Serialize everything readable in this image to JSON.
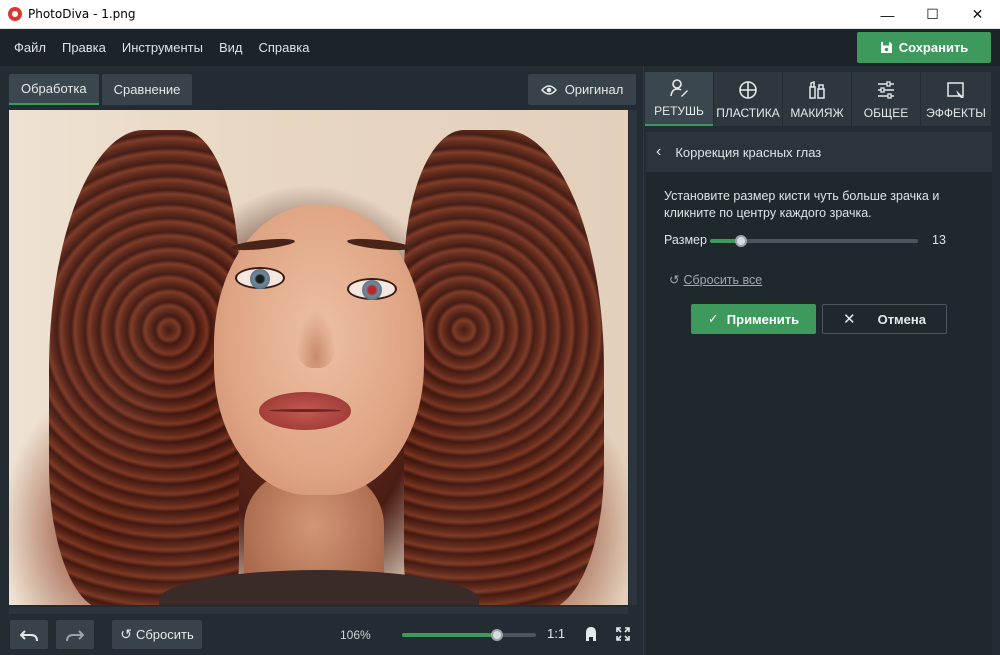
{
  "window": {
    "title": "PhotoDiva - 1.png",
    "minimize": "—",
    "maximize": "☐",
    "close": "✕"
  },
  "menu": {
    "items": [
      "Файл",
      "Правка",
      "Инструменты",
      "Вид",
      "Справка"
    ],
    "save_label": "Сохранить"
  },
  "editor": {
    "tabs": [
      "Обработка",
      "Сравнение"
    ],
    "active_tab": "Обработка",
    "original_label": "Оригинал",
    "reset_label": "Сбросить",
    "zoom_text": "106%",
    "zoom_level": 0.71,
    "one_to_one": "1:1"
  },
  "panel": {
    "tool_tabs": [
      {
        "label": "РЕТУШЬ",
        "icon": "retouch-icon"
      },
      {
        "label": "ПЛАСТИКА",
        "icon": "plastic-icon"
      },
      {
        "label": "МАКИЯЖ",
        "icon": "makeup-icon"
      },
      {
        "label": "ОБЩЕЕ",
        "icon": "sliders-icon"
      },
      {
        "label": "ЭФФЕКТЫ",
        "icon": "effects-icon"
      }
    ],
    "active_tool": "РЕТУШЬ",
    "section_title": "Коррекция красных глаз",
    "instruction": "Установите размер кисти чуть больше зрачка и кликните по центру каждого зрачка.",
    "size_label": "Размер",
    "size_value": "13",
    "size_level": 0.15,
    "reset_all": "Сбросить все",
    "apply_label": "Применить",
    "cancel_label": "Отмена"
  },
  "colors": {
    "accent": "#3e9a5c",
    "background": "#1f282e",
    "panel": "#232c32"
  }
}
